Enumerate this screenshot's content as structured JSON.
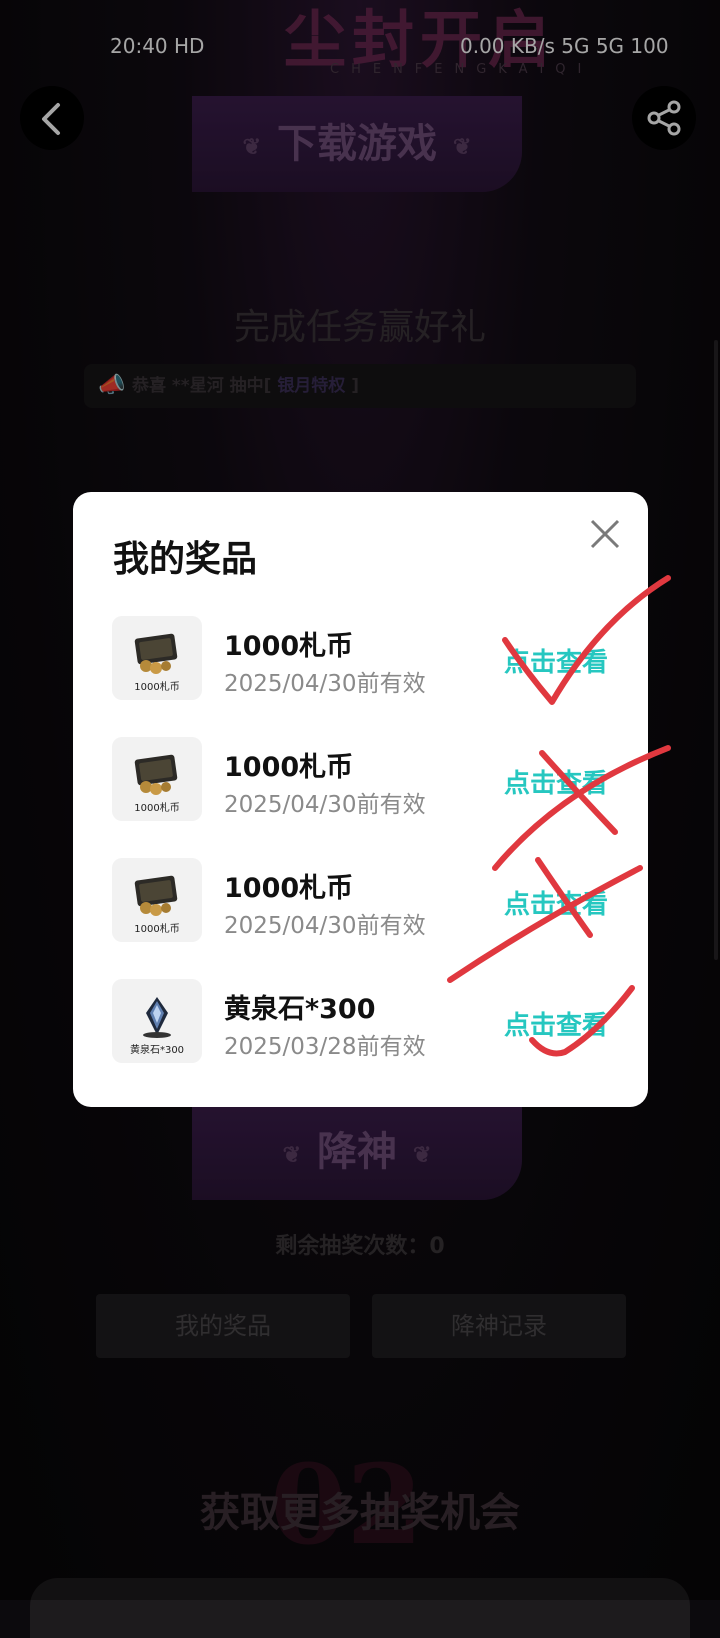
{
  "status_bar": {
    "left_text": "20:40 HD",
    "right_text": "0.00 KB/s 5G 5G 100"
  },
  "banner": {
    "title": "尘封开启",
    "subtitle": "CHENFENGKAIQI"
  },
  "header": {
    "download_label": "下载游戏"
  },
  "tasks_section": {
    "title": "完成任务赢好礼",
    "marquee_prefix": "恭喜 **星河 抽中[ ",
    "marquee_prize": "银月特权",
    "marquee_suffix": " ]"
  },
  "draw_section": {
    "descend_label": "降神",
    "remaining_text": "剩余抽奖次数：0",
    "my_prizes_label": "我的奖品",
    "descend_record_label": "降神记录"
  },
  "more_section": {
    "title": "获取更多抽奖机会",
    "number": "02"
  },
  "modal": {
    "title": "我的奖品",
    "items": [
      {
        "name": "1000札币",
        "validity": "2025/04/30前有效",
        "caption": "1000札币",
        "action": "点击查看",
        "icon": "coin-card-icon"
      },
      {
        "name": "1000札币",
        "validity": "2025/04/30前有效",
        "caption": "1000札币",
        "action": "点击查看",
        "icon": "coin-card-icon"
      },
      {
        "name": "1000札币",
        "validity": "2025/04/30前有效",
        "caption": "1000札币",
        "action": "点击查看",
        "icon": "coin-card-icon"
      },
      {
        "name": "黄泉石*300",
        "validity": "2025/03/28前有效",
        "caption": "黄泉石*300",
        "action": "点击查看",
        "icon": "crystal-icon"
      }
    ]
  },
  "colors": {
    "accent_link": "#26c7c0",
    "annotation_red": "#e0383f"
  }
}
